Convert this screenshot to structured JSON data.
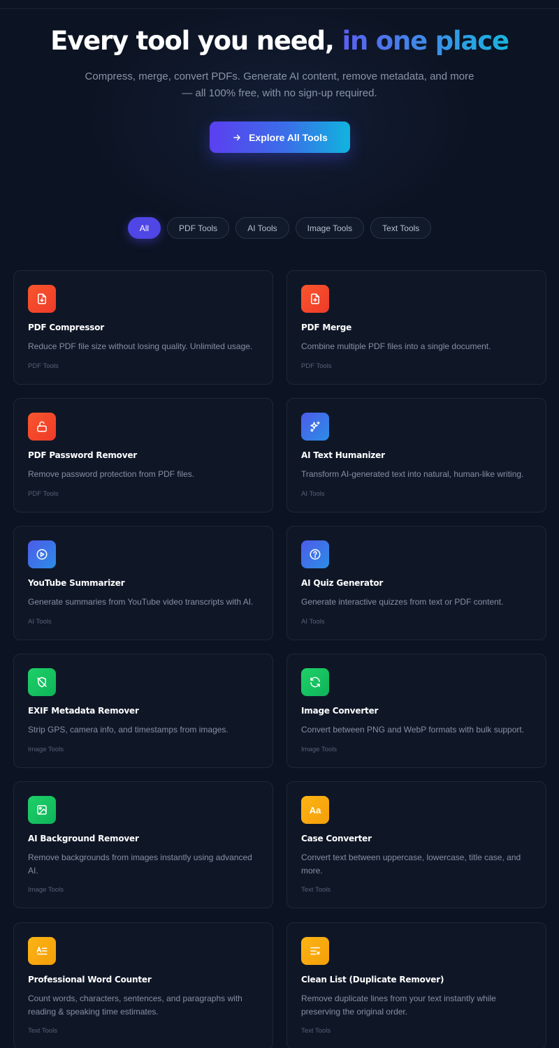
{
  "hero": {
    "title_main": "Every tool you need, ",
    "title_accent": "in one place",
    "subtitle": "Compress, merge, convert PDFs. Generate AI content, remove metadata, and more — all 100% free, with no sign-up required.",
    "cta_label": "Explore All Tools",
    "cta_icon": "arrow-right-icon"
  },
  "filters": {
    "active": "All",
    "items": [
      "All",
      "PDF Tools",
      "AI Tools",
      "Image Tools",
      "Text Tools"
    ]
  },
  "colors": {
    "pdf": "#f4472b",
    "ai": "#3d74e8",
    "image": "#17c461",
    "text": "#f8aa0f",
    "accent": "#4f46e5"
  },
  "tools": [
    {
      "name": "PDF Compressor",
      "description": "Reduce PDF file size without losing quality. Unlimited usage.",
      "category": "PDF Tools",
      "icon": "file-download-icon"
    },
    {
      "name": "PDF Merge",
      "description": "Combine multiple PDF files into a single document.",
      "category": "PDF Tools",
      "icon": "file-plus-icon"
    },
    {
      "name": "PDF Password Remover",
      "description": "Remove password protection from PDF files.",
      "category": "PDF Tools",
      "icon": "unlock-icon"
    },
    {
      "name": "AI Text Humanizer",
      "description": "Transform AI-generated text into natural, human-like writing.",
      "category": "AI Tools",
      "icon": "sparkles-icon"
    },
    {
      "name": "YouTube Summarizer",
      "description": "Generate summaries from YouTube video transcripts with AI.",
      "category": "AI Tools",
      "icon": "play-circle-icon"
    },
    {
      "name": "AI Quiz Generator",
      "description": "Generate interactive quizzes from text or PDF content.",
      "category": "AI Tools",
      "icon": "question-circle-icon"
    },
    {
      "name": "EXIF Metadata Remover",
      "description": "Strip GPS, camera info, and timestamps from images.",
      "category": "Image Tools",
      "icon": "shield-off-icon"
    },
    {
      "name": "Image Converter",
      "description": "Convert between PNG and WebP formats with bulk support.",
      "category": "Image Tools",
      "icon": "refresh-icon"
    },
    {
      "name": "AI Background Remover",
      "description": "Remove backgrounds from images instantly using advanced AI.",
      "category": "Image Tools",
      "icon": "image-icon"
    },
    {
      "name": "Case Converter",
      "description": "Convert text between uppercase, lowercase, title case, and more.",
      "category": "Text Tools",
      "icon": "text-case-icon"
    },
    {
      "name": "Professional Word Counter",
      "description": "Count words, characters, sentences, and paragraphs with reading & speaking time estimates.",
      "category": "Text Tools",
      "icon": "text-count-icon"
    },
    {
      "name": "Clean List (Duplicate Remover)",
      "description": "Remove duplicate lines from your text instantly while preserving the original order.",
      "category": "Text Tools",
      "icon": "list-remove-icon"
    }
  ]
}
